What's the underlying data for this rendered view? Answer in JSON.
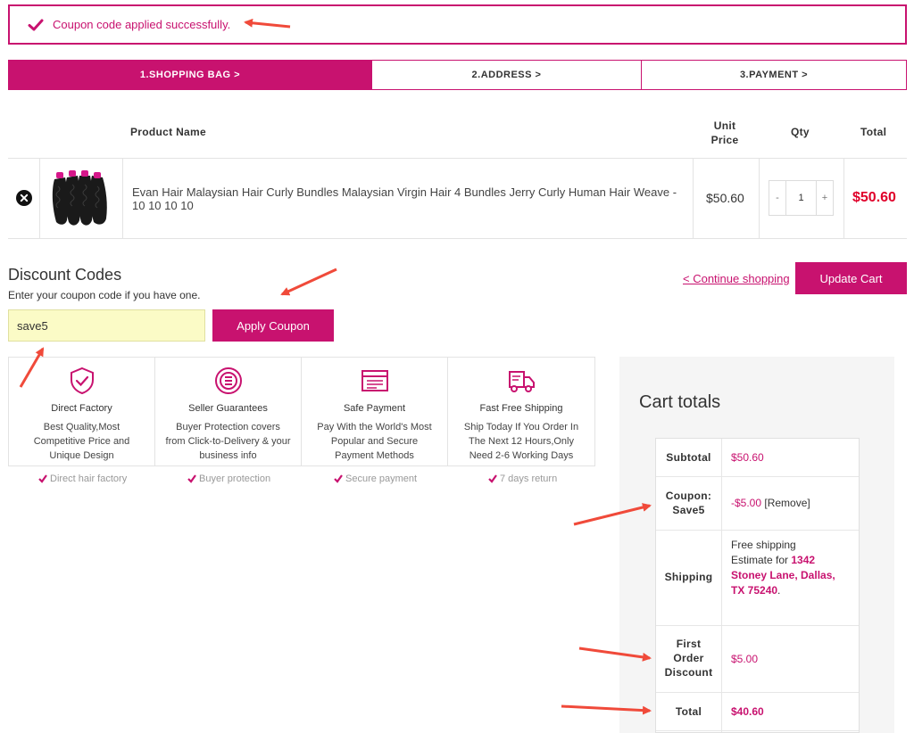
{
  "notice": {
    "text": "Coupon code applied successfully."
  },
  "steps": [
    {
      "label": "1.SHOPPING BAG >"
    },
    {
      "label": "2.ADDRESS >"
    },
    {
      "label": "3.PAYMENT >"
    }
  ],
  "table": {
    "headers": {
      "product": "Product Name",
      "unit_price_line1": "Unit",
      "unit_price_line2": "Price",
      "qty": "Qty",
      "total": "Total"
    },
    "item": {
      "name_line1": "Evan Hair Malaysian Hair Curly Bundles Malaysian Virgin Hair 4 Bundles Jerry Curly Human Hair Weave -",
      "name_line2": "10 10 10 10",
      "unit_price": "$50.60",
      "qty_minus": "-",
      "qty": "1",
      "qty_plus": "+",
      "total": "$50.60"
    }
  },
  "discount": {
    "title": "Discount Codes",
    "subtitle": "Enter your coupon code if you have one.",
    "input_value": "save5",
    "apply_label": "Apply Coupon",
    "continue_label": "< Continue shopping",
    "update_label": "Update Cart"
  },
  "features": [
    {
      "icon": "shield-check-icon",
      "title": "Direct Factory",
      "line1": "Best Quality,Most",
      "line2": "Competitive Price and",
      "line3": "Unique Design",
      "tag": "Direct hair factory"
    },
    {
      "icon": "badge-list-icon",
      "title": "Seller Guarantees",
      "line1": "Buyer Protection covers",
      "line2": "from Click-to-Delivery & your",
      "line3": "business info",
      "tag": "Buyer protection"
    },
    {
      "icon": "card-payment-icon",
      "title": "Safe Payment",
      "line1": "Pay With the World's Most",
      "line2": "Popular and Secure",
      "line3": "Payment Methods",
      "tag": "Secure payment"
    },
    {
      "icon": "delivery-truck-icon",
      "title": "Fast Free Shipping",
      "line1": "Ship Today If You Order In",
      "line2": "The Next 12 Hours,Only",
      "line3": "Need 2-6 Working Days",
      "tag": "7 days return"
    }
  ],
  "totals": {
    "title": "Cart totals",
    "subtotal_label": "Subtotal",
    "subtotal_value": "$50.60",
    "coupon_label_line1": "Coupon:",
    "coupon_label_line2": "Save5",
    "coupon_value": "-$5.00",
    "coupon_remove": "[Remove]",
    "shipping_label": "Shipping",
    "shipping_line1": "Free shipping",
    "shipping_line2_prefix": "Estimate for",
    "shipping_addr1": "1342",
    "shipping_addr2": "Stoney Lane, Dallas,",
    "shipping_addr3": "TX 75240",
    "shipping_dot": ".",
    "first_order_line1": "First",
    "first_order_line2": "Order",
    "first_order_line3": "Discount",
    "first_order_value": "$5.00",
    "total_label": "Total",
    "total_value": "$40.60"
  },
  "colors": {
    "accent": "#c8126f",
    "price_red": "#e0002a",
    "arrow": "#f04a3a"
  }
}
